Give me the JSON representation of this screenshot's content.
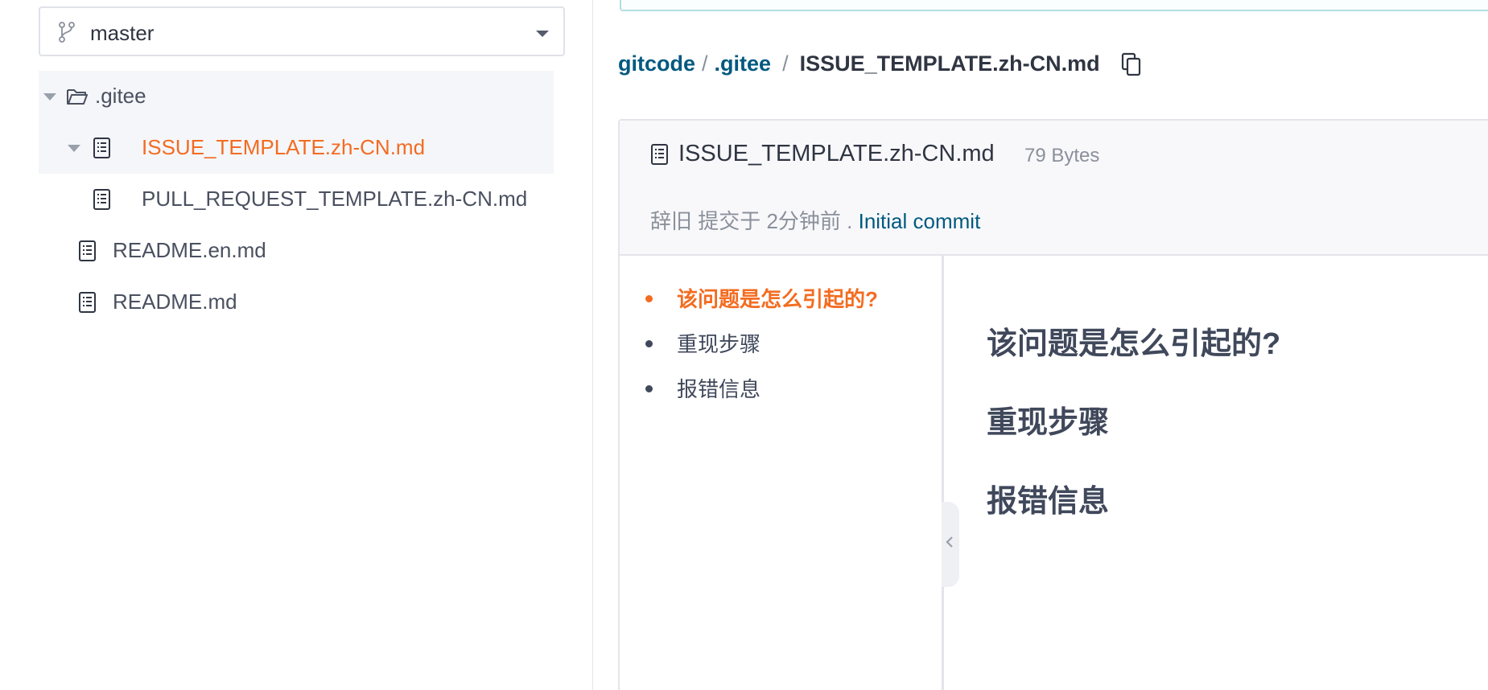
{
  "sidebar": {
    "branch": {
      "label": "master",
      "icon": "git-branch-icon"
    },
    "tree": [
      {
        "label": ".gitee",
        "type": "folder",
        "expanded": true
      },
      {
        "label": "ISSUE_TEMPLATE.zh-CN.md",
        "type": "file",
        "active": true
      },
      {
        "label": "PULL_REQUEST_TEMPLATE.zh-CN.md",
        "type": "file"
      },
      {
        "label": "README.en.md",
        "type": "file"
      },
      {
        "label": "README.md",
        "type": "file"
      }
    ]
  },
  "breadcrumb": {
    "root": "gitcode",
    "sep1": "/",
    "folder": ".gitee",
    "sep2": "/",
    "current": "ISSUE_TEMPLATE.zh-CN.md"
  },
  "file": {
    "name": "ISSUE_TEMPLATE.zh-CN.md",
    "size": "79 Bytes",
    "commit_author_text": "辞旧 提交于 2分钟前 .",
    "commit_message": "Initial commit"
  },
  "toc": [
    {
      "label": "该问题是怎么引起的?",
      "active": true
    },
    {
      "label": "重现步骤"
    },
    {
      "label": "报错信息"
    }
  ],
  "content": {
    "headings": [
      "该问题是怎么引起的?",
      "重现步骤",
      "报错信息"
    ]
  },
  "colors": {
    "accent": "#f36c21",
    "link": "#005980",
    "text": "#40485b"
  }
}
